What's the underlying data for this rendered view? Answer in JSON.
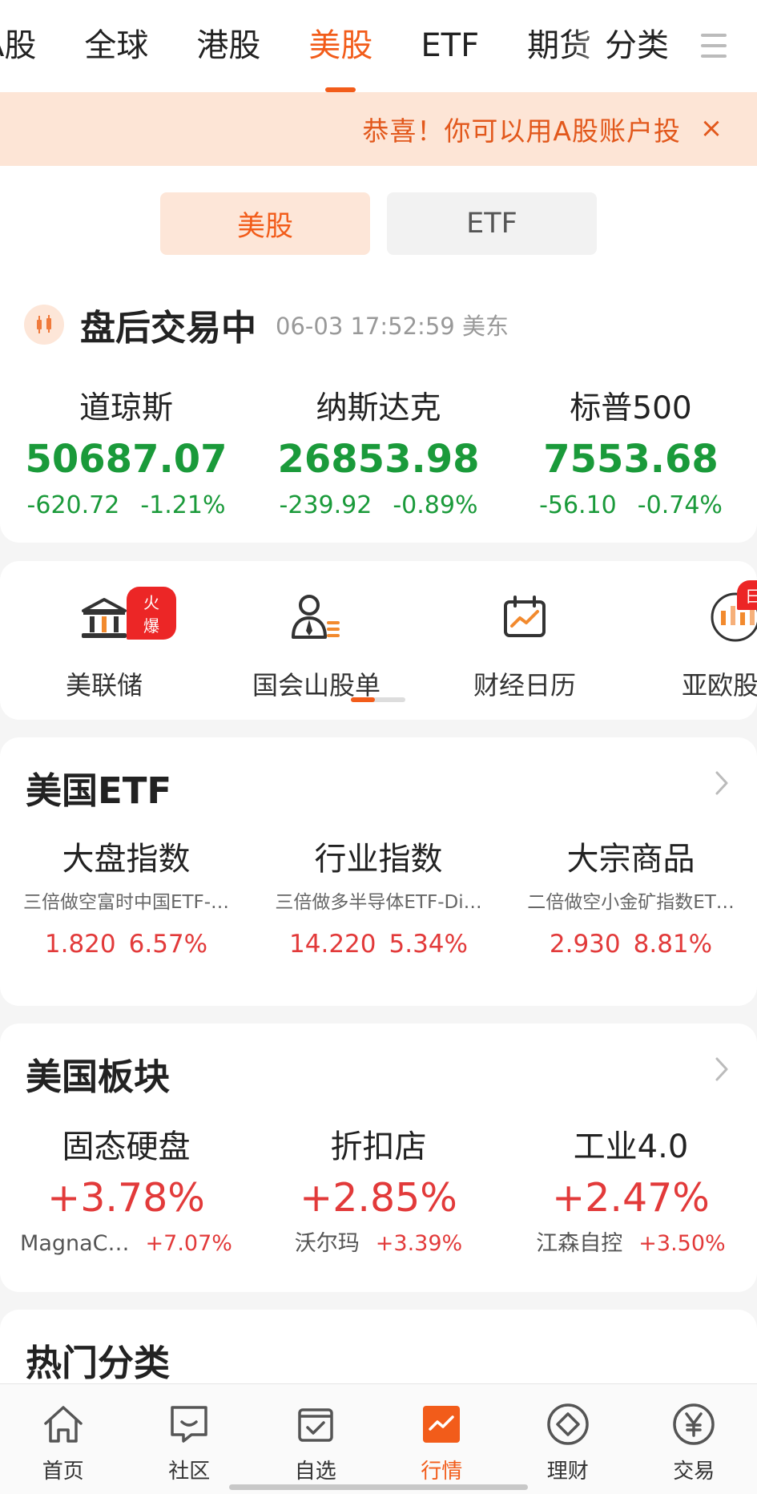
{
  "top_tabs": [
    {
      "label": "A股"
    },
    {
      "label": "全球"
    },
    {
      "label": "港股"
    },
    {
      "label": "美股",
      "active": true
    },
    {
      "label": "ETF"
    },
    {
      "label": "期货"
    },
    {
      "label": "分类"
    }
  ],
  "banner": {
    "text": "恭喜！你可以用A股账户投",
    "close": "×"
  },
  "segments": {
    "a": "美股",
    "b": "ETF"
  },
  "status": {
    "title": "盘后交易中",
    "time": "06-03 17:52:59 美东"
  },
  "indices": [
    {
      "name": "道琼斯",
      "value": "50687.07",
      "change": "-620.72",
      "pct": "-1.21%"
    },
    {
      "name": "纳斯达克",
      "value": "26853.98",
      "change": "-239.92",
      "pct": "-0.89%"
    },
    {
      "name": "标普500",
      "value": "7553.68",
      "change": "-56.10",
      "pct": "-0.74%"
    }
  ],
  "tools": [
    {
      "label": "美联储",
      "icon": "bank-icon",
      "badge": "火爆"
    },
    {
      "label": "国会山股单",
      "icon": "congress-person-icon"
    },
    {
      "label": "财经日历",
      "icon": "calendar-chart-icon"
    },
    {
      "label": "亚欧股",
      "icon": "globe-candles-icon",
      "badge": "日"
    }
  ],
  "us_etf": {
    "title": "美国ETF",
    "items": [
      {
        "name": "大盘指数",
        "sub": "三倍做空富时中国ETF-…",
        "price": "1.820",
        "pct": "6.57%"
      },
      {
        "name": "行业指数",
        "sub": "三倍做多半导体ETF-Di…",
        "price": "14.220",
        "pct": "5.34%"
      },
      {
        "name": "大宗商品",
        "sub": "二倍做空小金矿指数ET…",
        "price": "2.930",
        "pct": "8.81%"
      }
    ]
  },
  "us_sectors": {
    "title": "美国板块",
    "items": [
      {
        "name": "固态硬盘",
        "pct": "+3.78%",
        "stock": "MagnaC…",
        "stock_pct": "+7.07%"
      },
      {
        "name": "折扣店",
        "pct": "+2.85%",
        "stock": "沃尔玛",
        "stock_pct": "+3.39%"
      },
      {
        "name": "工业4.0",
        "pct": "+2.47%",
        "stock": "江森自控",
        "stock_pct": "+3.50%"
      }
    ]
  },
  "hot": {
    "title": "热门分类"
  },
  "bottom_nav": [
    {
      "label": "首页",
      "icon": "home-icon"
    },
    {
      "label": "社区",
      "icon": "chat-icon"
    },
    {
      "label": "自选",
      "icon": "checklist-icon"
    },
    {
      "label": "行情",
      "icon": "market-chart-icon",
      "active": true
    },
    {
      "label": "理财",
      "icon": "diamond-icon"
    },
    {
      "label": "交易",
      "icon": "yuan-icon"
    }
  ],
  "colors": {
    "accent": "#f25c1a",
    "down": "#1a9a3a",
    "up": "#e23a3a"
  }
}
